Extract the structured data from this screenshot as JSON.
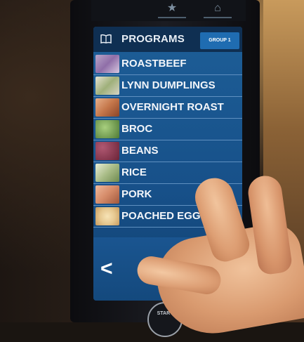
{
  "header": {
    "title": "PROGRAMS",
    "group_tab": "GROUP 1",
    "icon": "book-icon"
  },
  "programs": [
    {
      "label": "ROASTBEEF",
      "thumb_color": "#b9a6c8"
    },
    {
      "label": "LYNN DUMPLINGS",
      "thumb_color": "#d7d4c4"
    },
    {
      "label": "OVERNIGHT ROAST",
      "thumb_color": "#c4764a"
    },
    {
      "label": "BROC",
      "thumb_color": "#6f9a4e"
    },
    {
      "label": "BEANS",
      "thumb_color": "#8a3b52"
    },
    {
      "label": "RICE",
      "thumb_color": "#a9bc87"
    },
    {
      "label": "PORK",
      "thumb_color": "#d48a68"
    },
    {
      "label": "POACHED EGG",
      "thumb_color": "#e6c890"
    }
  ],
  "nav": {
    "prev": "<",
    "next": ">"
  },
  "start_button": "START",
  "top_buttons": [
    "favorites-icon",
    "door-icon"
  ]
}
